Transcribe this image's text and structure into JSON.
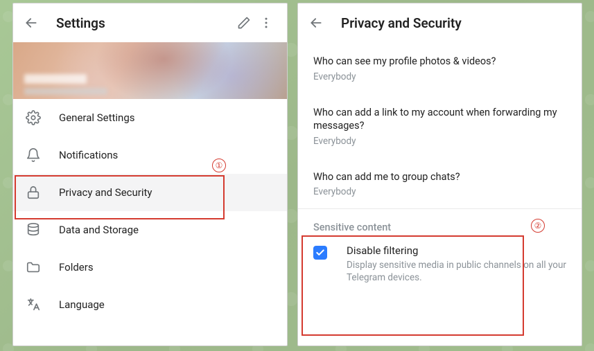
{
  "settings": {
    "title": "Settings",
    "items": [
      {
        "icon": "gear",
        "label": "General Settings"
      },
      {
        "icon": "bell",
        "label": "Notifications"
      },
      {
        "icon": "lock",
        "label": "Privacy and Security"
      },
      {
        "icon": "database",
        "label": "Data and Storage"
      },
      {
        "icon": "folder",
        "label": "Folders"
      },
      {
        "icon": "language",
        "label": "Language"
      }
    ],
    "selected_index": 2
  },
  "privacy": {
    "title": "Privacy and Security",
    "items": [
      {
        "title": "Who can see my profile photos & videos?",
        "value": "Everybody"
      },
      {
        "title": "Who can add a link to my account when forwarding my messages?",
        "value": "Everybody"
      },
      {
        "title": "Who can add me to group chats?",
        "value": "Everybody"
      }
    ],
    "sensitive": {
      "section_label": "Sensitive content",
      "checkbox_checked": true,
      "title": "Disable filtering",
      "description": "Display sensitive media in public channels on all your Telegram devices."
    }
  },
  "annotations": {
    "badge1": "①",
    "badge2": "②"
  }
}
